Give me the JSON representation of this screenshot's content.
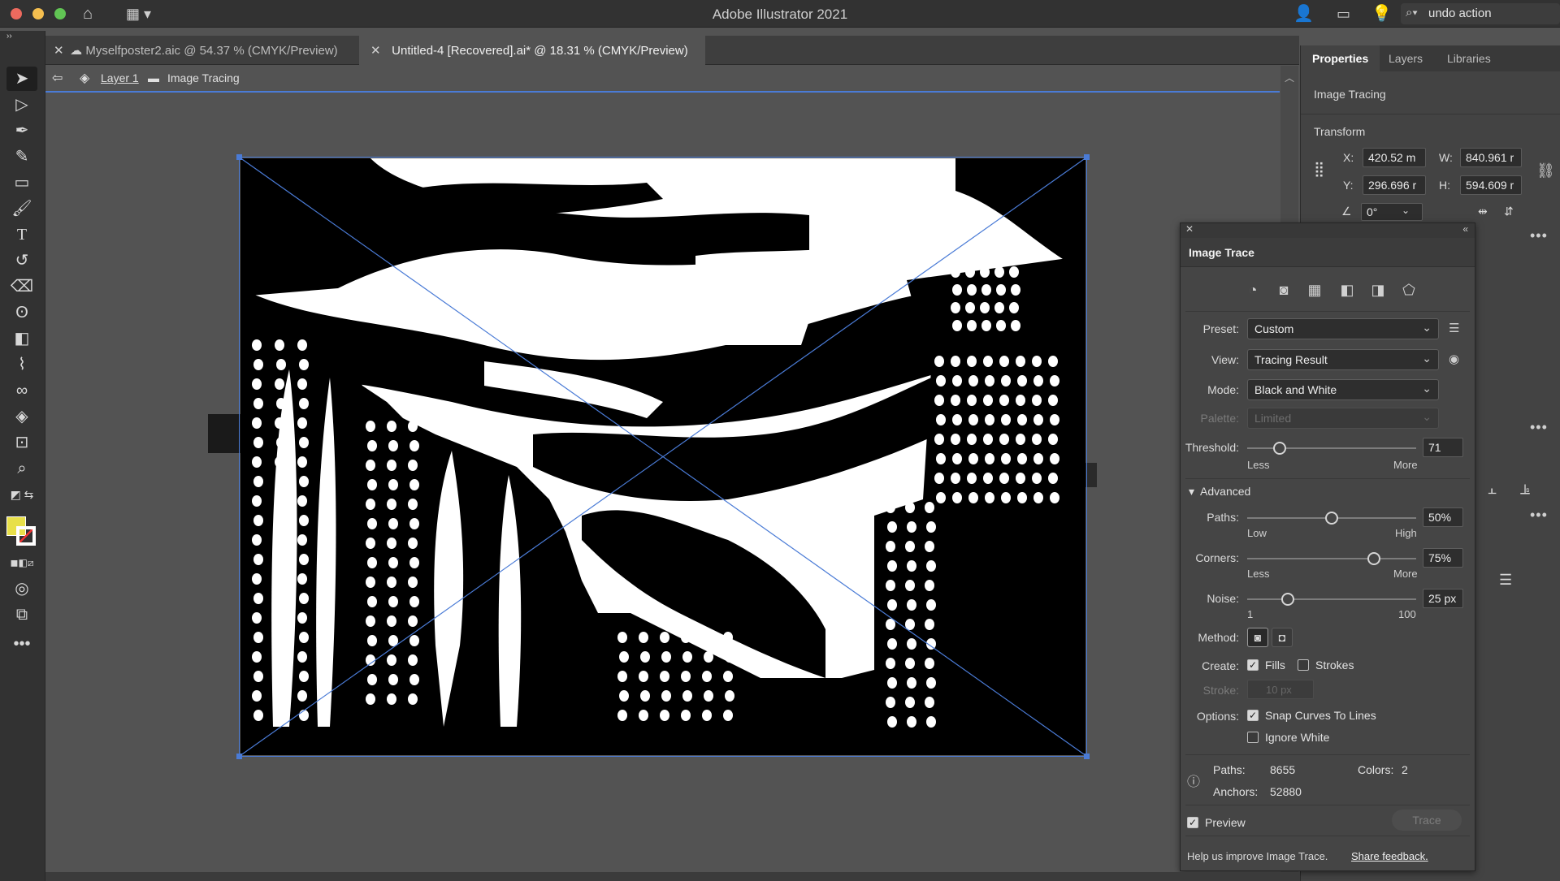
{
  "window": {
    "title": "Adobe Illustrator 2021",
    "search_value": "undo action",
    "traffic_colors": [
      "#ed6a5e",
      "#f5bf4f",
      "#61c554"
    ]
  },
  "doc_tabs": [
    {
      "label": "Myselfposter2.aic @ 54.37 % (CMYK/Preview)",
      "active": false
    },
    {
      "label": "Untitled-4 [Recovered].ai* @ 18.31 % (CMYK/Preview)",
      "active": true
    }
  ],
  "breadcrumb": {
    "layer": "Layer 1",
    "object": "Image Tracing"
  },
  "properties": {
    "tabs": [
      "Properties",
      "Layers",
      "Libraries"
    ],
    "selection_type": "Image Tracing",
    "transform_title": "Transform",
    "x_label": "X:",
    "x_value": "420.52 m",
    "y_label": "Y:",
    "y_value": "296.696 r",
    "w_label": "W:",
    "w_value": "840.961 r",
    "h_label": "H:",
    "h_value": "594.609 r",
    "angle_value": "0°"
  },
  "image_trace": {
    "title": "Image Trace",
    "preset_label": "Preset:",
    "preset_value": "Custom",
    "view_label": "View:",
    "view_value": "Tracing Result",
    "mode_label": "Mode:",
    "mode_value": "Black and White",
    "palette_label": "Palette:",
    "palette_value": "Limited",
    "threshold_label": "Threshold:",
    "threshold_value": "71",
    "threshold_level": 0.19,
    "threshold_min": "Less",
    "threshold_max": "More",
    "advanced_label": "Advanced",
    "paths_label": "Paths:",
    "paths_value": "50%",
    "paths_level": 0.5,
    "paths_min": "Low",
    "paths_max": "High",
    "corners_label": "Corners:",
    "corners_value": "75%",
    "corners_level": 0.75,
    "corners_min": "Less",
    "corners_max": "More",
    "noise_label": "Noise:",
    "noise_value": "25 px",
    "noise_level": 0.24,
    "noise_min": "1",
    "noise_max": "100",
    "method_label": "Method:",
    "create_label": "Create:",
    "fills_label": "Fills",
    "fills_checked": true,
    "strokes_label": "Strokes",
    "strokes_checked": false,
    "stroke_label": "Stroke:",
    "stroke_value": "10 px",
    "options_label": "Options:",
    "snap_label": "Snap Curves To Lines",
    "snap_checked": true,
    "ignore_white_label": "Ignore White",
    "ignore_white_checked": false,
    "stats_paths_label": "Paths:",
    "stats_paths_value": "8655",
    "stats_anchors_label": "Anchors:",
    "stats_anchors_value": "52880",
    "stats_colors_label": "Colors:",
    "stats_colors_value": "2",
    "preview_label": "Preview",
    "preview_checked": true,
    "trace_button": "Trace",
    "feedback_text": "Help us improve Image Trace.",
    "feedback_link": "Share feedback."
  },
  "colors": {
    "fill_swatch": "#e8e04a",
    "selection_blue": "#4a7bd6"
  }
}
